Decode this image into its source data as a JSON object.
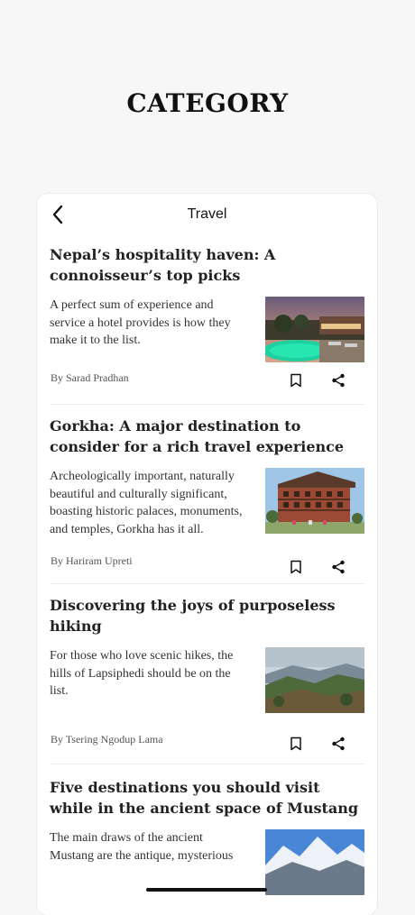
{
  "page": {
    "title": "CATEGORY"
  },
  "header": {
    "title": "Travel"
  },
  "articles": [
    {
      "title": "Nepal’s hospitality haven: A connoisseur’s top picks",
      "excerpt": "A perfect sum of experience and service a hotel provides is how they make it to the list.",
      "author": "By Sarad Pradhan",
      "image": "hotel-pool-photo"
    },
    {
      "title": "Gorkha: A major destination to consider for a rich travel experience",
      "excerpt": "Archeologically important, naturally beautiful and culturally significant, boasting historic palaces, monuments, and temples, Gorkha has it all.",
      "author": "By Hariram Upreti",
      "image": "historic-palace-photo"
    },
    {
      "title": "Discovering the joys of purposeless hiking",
      "excerpt": "For those who love scenic hikes, the hills of Lapsiphedi should be on the list.",
      "author": "By Tsering Ngodup Lama",
      "image": "hills-landscape-photo"
    },
    {
      "title": "Five destinations you should visit while in the ancient space of Mustang",
      "excerpt": "The main draws of the ancient Mustang are the antique, mysterious",
      "author": "",
      "image": "snowy-mountain-photo"
    }
  ],
  "icons": {
    "back": "chevron-left-icon",
    "bookmark": "bookmark-icon",
    "share": "share-icon"
  }
}
